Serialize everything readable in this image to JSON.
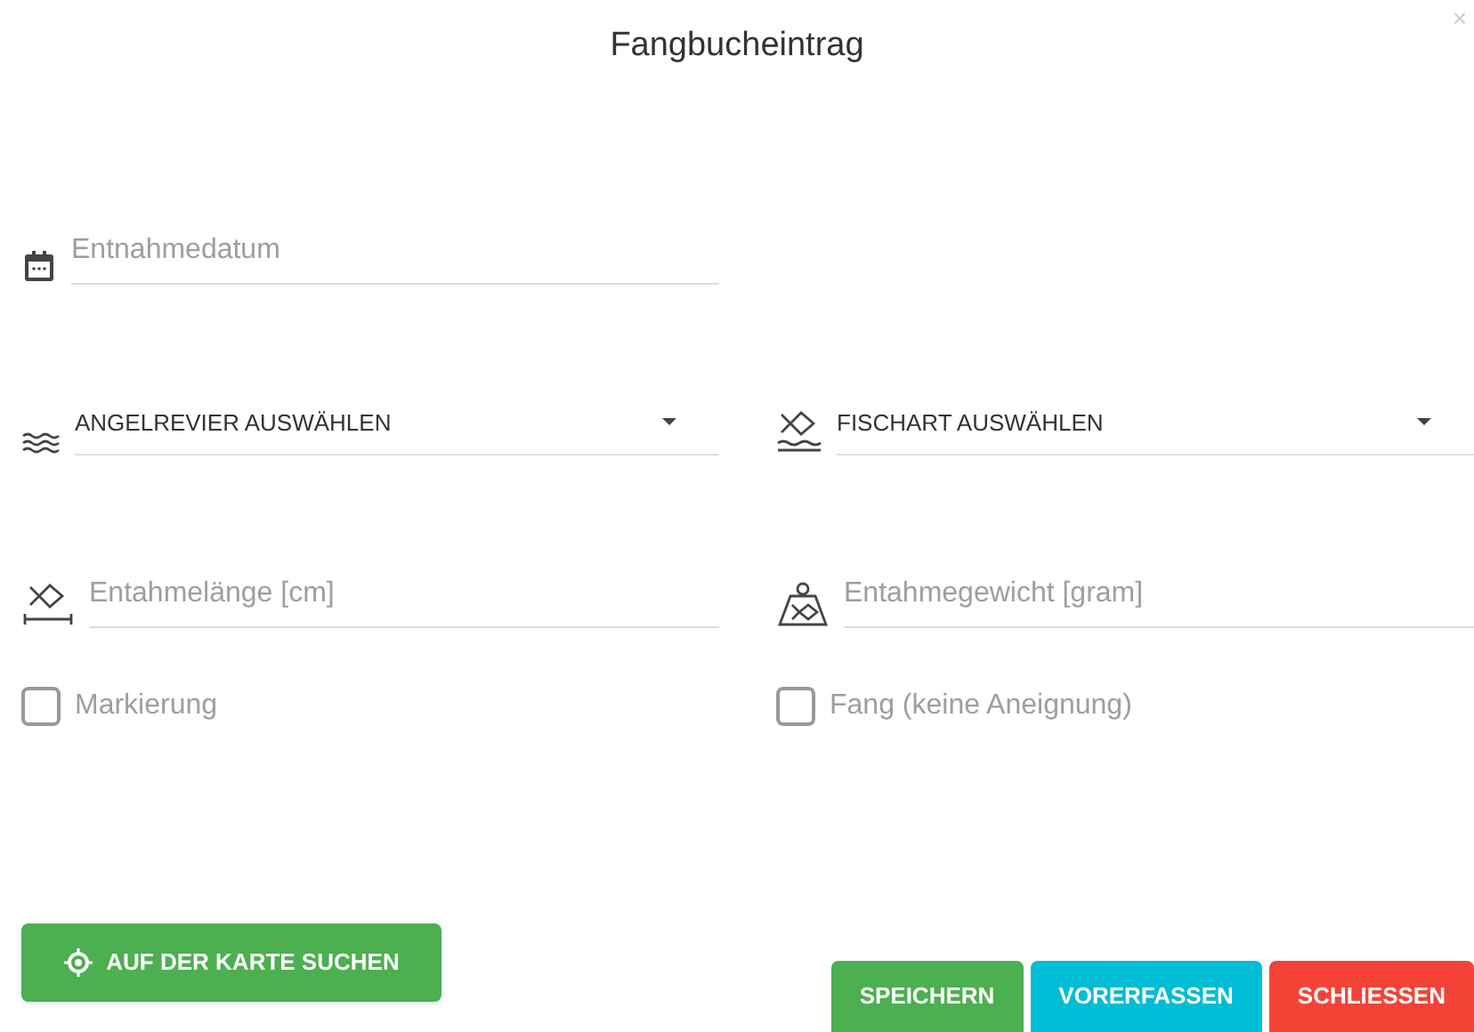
{
  "dialog": {
    "title": "Fangbucheintrag",
    "close": "×"
  },
  "rows": [
    [
      {
        "kind": "date",
        "placeholder": "Entnahmedatum"
      }
    ],
    [
      {
        "kind": "water",
        "value": "ANGELREVIER AUSWÄHLEN"
      },
      {
        "kind": "fish",
        "value": "FISCHART AUSWÄHLEN"
      }
    ],
    [
      {
        "kind": "length",
        "placeholder": "Entahmelänge [cm]"
      },
      {
        "kind": "weight",
        "placeholder": "Entahmegewicht [gram]"
      }
    ]
  ],
  "checkboxes": [
    {
      "label": "Markierung",
      "checked": false
    },
    {
      "label": "Fang (keine Aneignung)",
      "checked": false
    }
  ],
  "map_button": "AUF DER KARTE SUCHEN",
  "buttons": [
    {
      "label": "SPEICHERN",
      "color": "#4caf50"
    },
    {
      "label": "VORERFASSEN",
      "color": "#00bcd4"
    },
    {
      "label": "SCHLIESSEN",
      "color": "#f44336"
    }
  ]
}
